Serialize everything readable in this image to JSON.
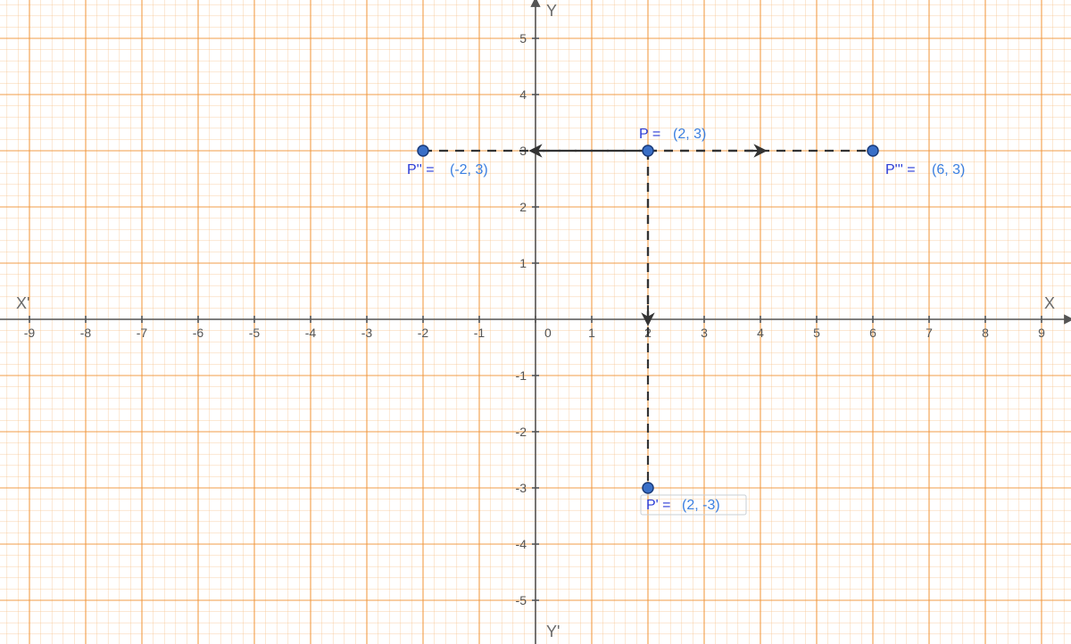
{
  "chart_data": {
    "type": "scatter",
    "title": "",
    "xlabel": "",
    "ylabel": "",
    "x_range": [
      -9.5,
      9.5
    ],
    "y_range": [
      -5.7,
      5.6
    ],
    "x_ticks": [
      -9,
      -8,
      -7,
      -6,
      -5,
      -4,
      -3,
      -2,
      -1,
      0,
      1,
      2,
      3,
      4,
      5,
      6,
      7,
      8,
      9
    ],
    "y_ticks": [
      -5,
      -4,
      -3,
      -2,
      -1,
      1,
      2,
      3,
      4,
      5
    ],
    "grid": {
      "major": 1,
      "minor": 0.2
    },
    "axis_names": {
      "x_pos": "X",
      "x_neg": "X'",
      "y_pos": "Y",
      "y_neg": "Y'"
    },
    "points": [
      {
        "id": "P",
        "x": 2,
        "y": 3,
        "label_name": "P =",
        "label_coord": "(2, 3)"
      },
      {
        "id": "P'",
        "x": 2,
        "y": -3,
        "label_name": "P' =",
        "label_coord": "(2, -3)"
      },
      {
        "id": "P''",
        "x": -2,
        "y": 3,
        "label_name": "P'' =",
        "label_coord": "(-2, 3)"
      },
      {
        "id": "P'''",
        "x": 6,
        "y": 3,
        "label_name": "P''' =",
        "label_coord": "(6, 3)"
      }
    ],
    "segments": [
      {
        "from": "P''",
        "to": "P",
        "arrow_at": [
          0,
          3
        ]
      },
      {
        "from": "P",
        "to": "P'''",
        "arrow_at": [
          4,
          3
        ]
      },
      {
        "from": "P",
        "to": "P'",
        "arrow_at": [
          2,
          0
        ]
      }
    ]
  },
  "zero_label": "0"
}
